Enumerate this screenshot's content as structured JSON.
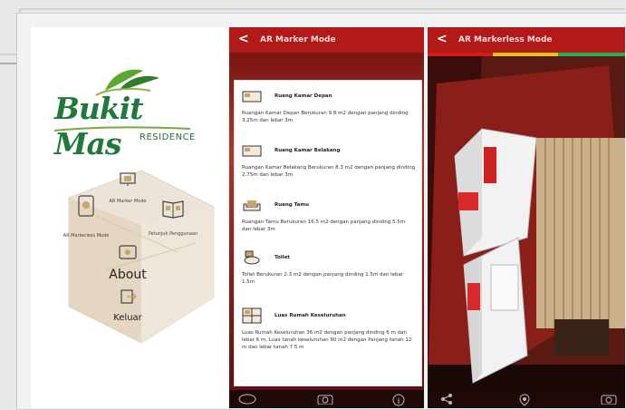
{
  "panel1": {
    "logo": {
      "brand": "Bukit Mas",
      "sub": "RESIDENCE"
    },
    "menu": {
      "ar_marker": "AR Marker Mode",
      "ar_markerless": "AR Markerless Mode",
      "petunjuk": "Petunjuk Penggunaan",
      "about": "About",
      "keluar": "Keluar"
    }
  },
  "panel2": {
    "title": "AR Marker Mode",
    "back": "<",
    "rooms": [
      {
        "title": "Ruang Kamar Depan",
        "desc": "Ruangan Kamar Depan Berukuran 9.8 m2 dengan panjang dinding 3.25m dan lebar 3m"
      },
      {
        "title": "Ruang Kamar Belakang",
        "desc": "Ruangan Kamar Belakang Berukuran 8.3 m2 dengan panjang dinding 2.75m dan lebar 3m"
      },
      {
        "title": "Ruang Tamu",
        "desc": "Ruangan Tamu Berukuran 16.5 m2 dengan panjang dinding 5.5m dan lebar 3m"
      },
      {
        "title": "Toilet",
        "desc": "Toilet Berukuran 2.3 m2 dengan panjang dinding 1.5m dan lebar 1.5m"
      },
      {
        "title": "Luas Rumah Keseluruhan",
        "desc": "Luas Rumah Keseluruhan 36 m2 dengan panjang dinding  6 m dan lebar 6 m, Luas tanah keseluruhan 90 m2 dengan Panjang tanah 12 m dan lebar tanah 7.5 m"
      }
    ],
    "bottom_icons": [
      "auto-icon",
      "camera-icon",
      "info-icon"
    ]
  },
  "panel3": {
    "title": "AR Markerless Mode",
    "back": "<",
    "progress_colors": [
      "#d41c1c",
      "#e6c21a",
      "#2fa84a"
    ],
    "bottom_icons": [
      "share-icon",
      "location-icon",
      "camera-icon"
    ]
  },
  "colors": {
    "accent": "#b21a1a",
    "brand": "#1f7a3a"
  }
}
